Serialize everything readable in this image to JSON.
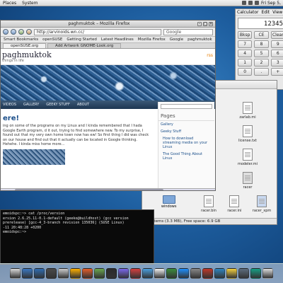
{
  "top_panel": {
    "menus": [
      "Places",
      "System"
    ],
    "clock": "Fri Sep 5,"
  },
  "firefox": {
    "title": "paghmuktok – Mozilla Firefox",
    "url": "http://arvinoids.wn.cc/",
    "search_placeholder": "Google",
    "bookmarks": [
      "Smart Bookmarks",
      "openSUSE",
      "Getting Started",
      "Latest Headlines",
      "Mozilla Firefox",
      "Google",
      "paghmuktok"
    ],
    "tabs": [
      "openSUSE.org",
      "Add Artwork GNOME-Look.org"
    ],
    "site": {
      "title": "paghmuktok",
      "tagline": "things in life",
      "rss": "rss",
      "nav": [
        "VIDEOS",
        "GALLERY",
        "GEEKY STUFF",
        "ABOUT"
      ],
      "post_title": "ere!",
      "post_text": "ing on some of the programs on my Linux and I kinda remembered that I hada Google Earth program, d it out, trying to find somewhere new. To my surprise, I found out that my very own home town now has ew! So first thing I did was check on our house and find out that it actually can be located in Google thinking. Hehehe. I kinda miss home more…",
      "sidebar_title": "Pages",
      "sidebar_links": [
        "Gallery",
        "Geeky Stuff",
        "How to download streaming media on your Linux",
        "The Good Thing About Linux"
      ]
    }
  },
  "calculator": {
    "menus": [
      "Calculator",
      "Edit",
      "View",
      "He"
    ],
    "display": "12345",
    "keys": [
      [
        "Bksp",
        "CE",
        "Clear"
      ],
      [
        "7",
        "8",
        "9"
      ],
      [
        "4",
        "5",
        "6"
      ],
      [
        "1",
        "2",
        "3"
      ],
      [
        "0",
        ".",
        "+"
      ]
    ]
  },
  "file_manager": {
    "files": [
      "zarlab.mi",
      "license.txt",
      "modeler.mi",
      "racer"
    ],
    "bottom_files": [
      "racer.bin",
      "racer.ini",
      "racer_xpm"
    ],
    "sidebar_item": "windows",
    "status": "(20 items (3.3 MB), Free space: 6.9 GB"
  },
  "terminal": {
    "lines": [
      "emoidspc:~> cat /proc/version",
      "ersion 2.6.25.11-0.1-default (geeko@buildhost) (gcc version",
      "prerelease) [gcc-4_3-branch revision 135036] (SUSE Linux)",
      "-11 20:48:28 +0200",
      "emoidspc:~>"
    ]
  },
  "dock": {
    "colors": [
      "#d9d9d9",
      "#3a78c2",
      "#2f6db3",
      "#4a4a4a",
      "#cccccc",
      "#ffb000",
      "#e65f2b",
      "#6aa84f",
      "#2b2b2b",
      "#7b68ee",
      "#d64040",
      "#4aa0e0",
      "#f0f0f0",
      "#3c8d3c",
      "#1e90ff",
      "#888888",
      "#c0392b",
      "#2e86c1",
      "#f4d03f",
      "#5d6d7e",
      "#16a085",
      "#dddddd"
    ]
  }
}
